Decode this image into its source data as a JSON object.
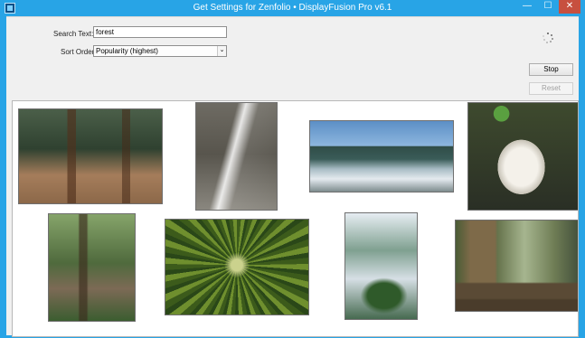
{
  "window": {
    "title": "Get Settings for Zenfolio • DisplayFusion Pro v6.1",
    "minimize_glyph": "—",
    "maximize_glyph": "☐",
    "close_glyph": "✕"
  },
  "form": {
    "search_label": "Search Text:",
    "search_value": "forest",
    "sort_label": "Sort Order:",
    "sort_value": "Popularity (highest)",
    "sort_arrow": "⌄"
  },
  "buttons": {
    "stop": "Stop",
    "reset": "Reset"
  },
  "results": {
    "image_icons": [
      "forest-trail-photo",
      "light-beam-forest-photo",
      "misty-hills-photo",
      "mushroom-forest-photo",
      "forest-stump-photo",
      "bamboo-canopy-photo",
      "misty-tree-photo",
      "redwood-forest-photo"
    ]
  },
  "colors": {
    "title_bar": "#28a4e6",
    "close_button": "#c7503f",
    "client_background": "#f0f0f0"
  }
}
